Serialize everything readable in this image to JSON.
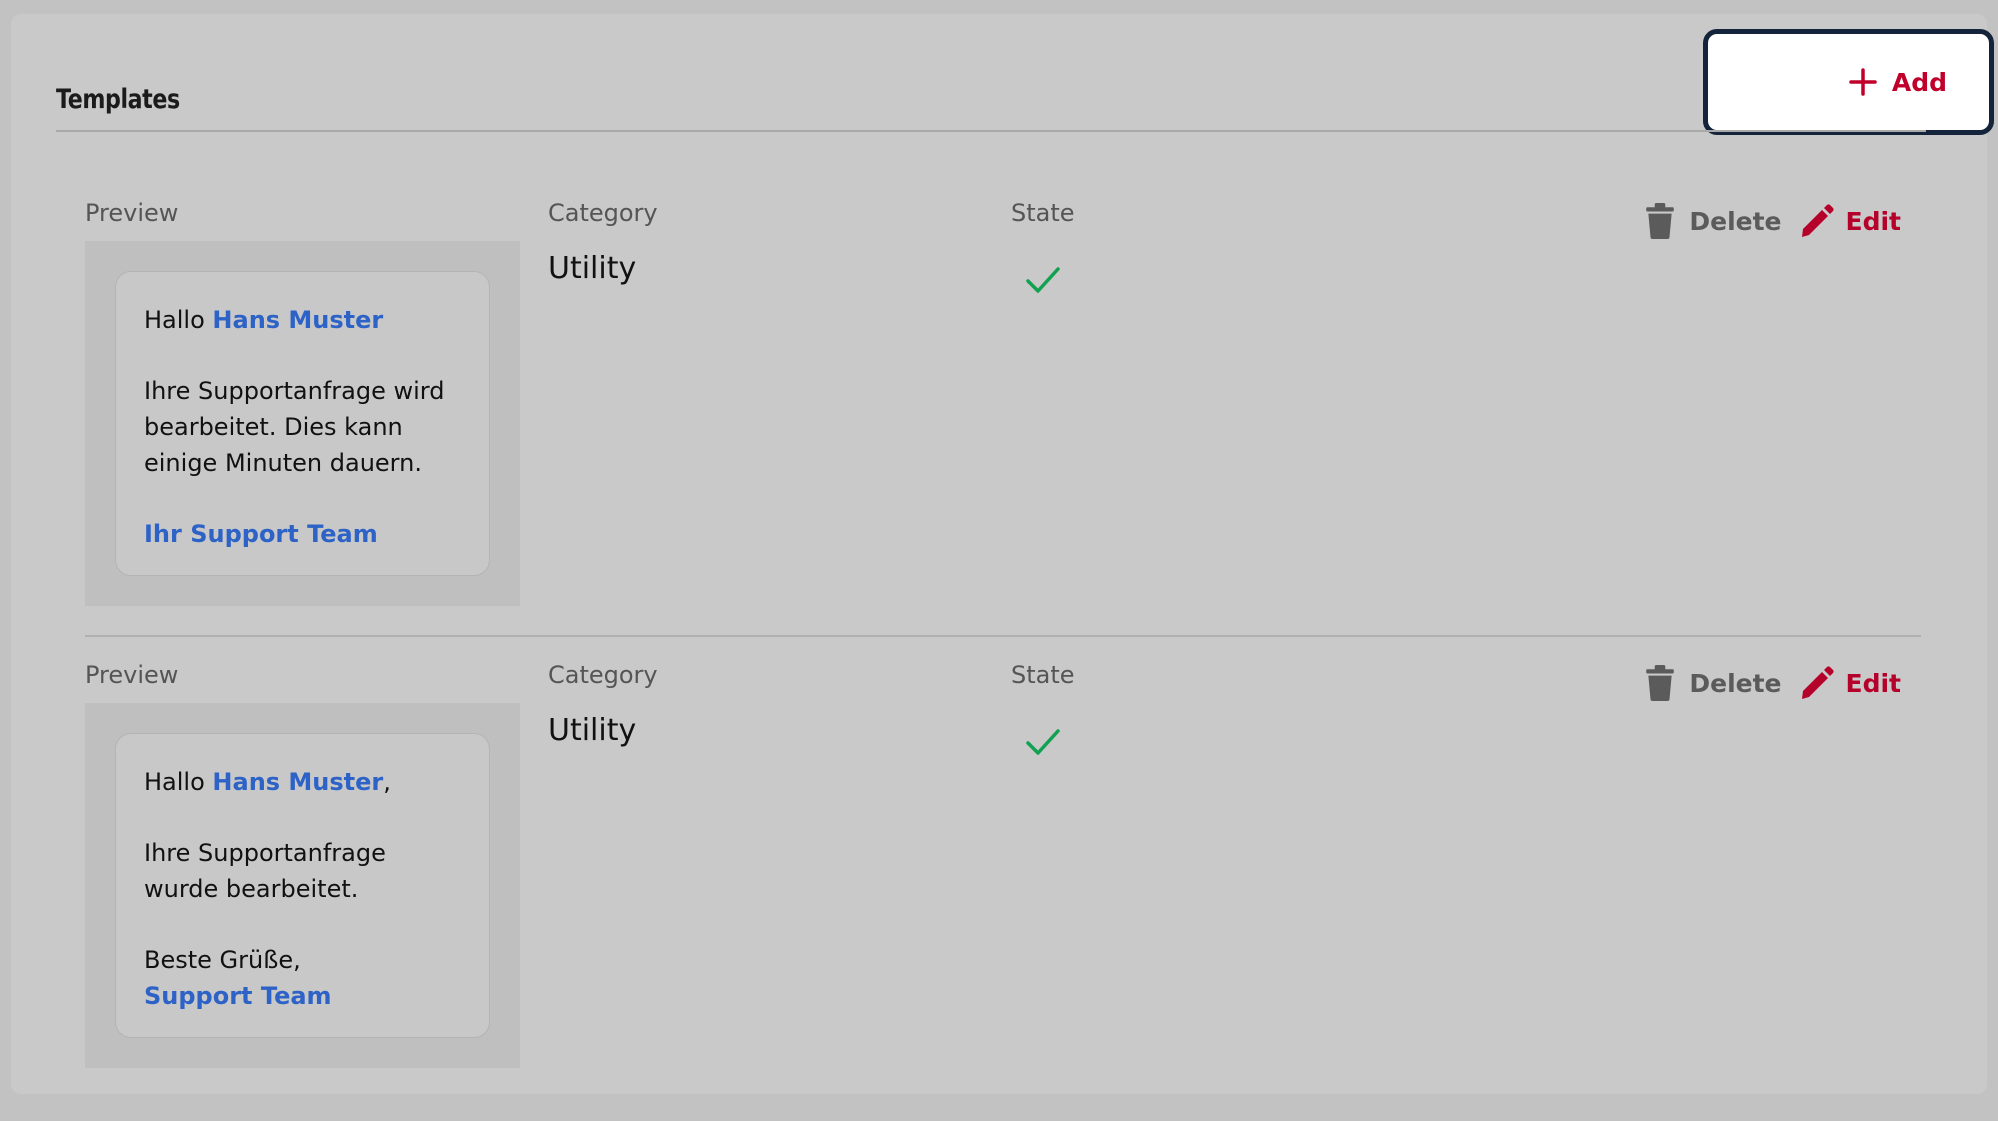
{
  "header": {
    "title": "Templates",
    "add_label": "Add"
  },
  "columns": {
    "preview": "Preview",
    "category": "Category",
    "state": "State"
  },
  "actions": {
    "delete_label": "Delete",
    "edit_label": "Edit"
  },
  "templates": [
    {
      "category": "Utility",
      "state": "approved",
      "preview": {
        "greeting": "Hallo ",
        "name": "Hans Muster",
        "greeting_suffix": "",
        "body": "Ihre Supportanfrage wird bearbeitet. Dies kann einige Minuten dauern.",
        "closing": "",
        "signature": "Ihr Support Team"
      }
    },
    {
      "category": "Utility",
      "state": "approved",
      "preview": {
        "greeting": "Hallo ",
        "name": "Hans Muster",
        "greeting_suffix": ",",
        "body": "Ihre Supportanfrage wurde bearbeitet.",
        "closing": "Beste Grüße,",
        "signature": "Support Team"
      }
    }
  ],
  "colors": {
    "accent": "#c0002b",
    "highlight": "#2d62c7",
    "check": "#12a150"
  }
}
